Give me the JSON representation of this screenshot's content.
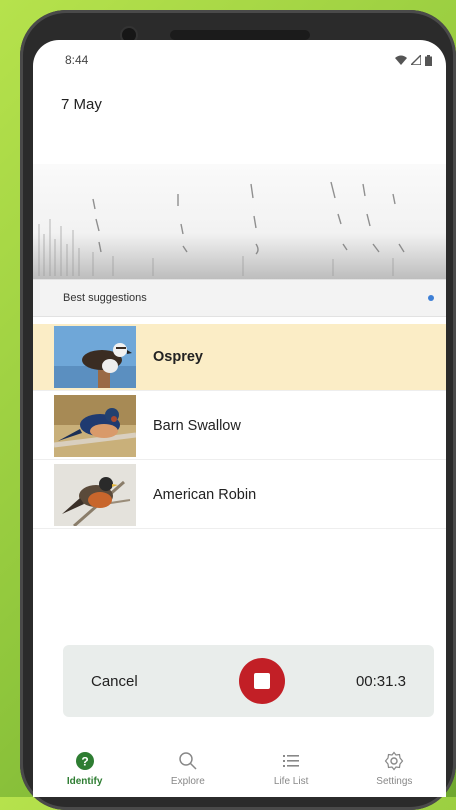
{
  "status_bar": {
    "time": "8:44",
    "icons": [
      "wifi-icon",
      "signal-icon",
      "battery-icon"
    ]
  },
  "header": {
    "date": "7 May"
  },
  "suggestions": {
    "title": "Best suggestions",
    "items": [
      {
        "name": "Osprey",
        "selected": true
      },
      {
        "name": "Barn Swallow",
        "selected": false
      },
      {
        "name": "American Robin",
        "selected": false
      }
    ]
  },
  "recorder": {
    "cancel_label": "Cancel",
    "elapsed": "00:31.3"
  },
  "nav": {
    "items": [
      {
        "label": "Identify",
        "icon": "identify-icon",
        "active": true
      },
      {
        "label": "Explore",
        "icon": "search-icon",
        "active": false
      },
      {
        "label": "Life List",
        "icon": "list-icon",
        "active": false
      },
      {
        "label": "Settings",
        "icon": "gear-icon",
        "active": false
      }
    ]
  },
  "colors": {
    "accent": "#2e7d32",
    "record": "#c21f26",
    "selected_row": "#fbedc6",
    "info_dot": "#3d7fd6"
  }
}
